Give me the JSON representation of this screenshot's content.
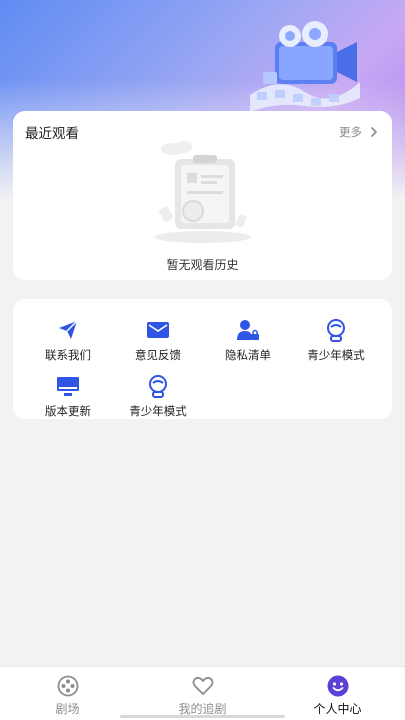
{
  "recent": {
    "title": "最近观看",
    "more_label": "更多",
    "empty_text": "暂无观看历史"
  },
  "tools": {
    "items": [
      {
        "label": "联系我们",
        "icon": "send-icon"
      },
      {
        "label": "意见反馈",
        "icon": "mail-icon"
      },
      {
        "label": "隐私清单",
        "icon": "privacy-user-icon"
      },
      {
        "label": "青少年模式",
        "icon": "teen-mode-icon"
      },
      {
        "label": "版本更新",
        "icon": "monitor-icon"
      },
      {
        "label": "青少年模式",
        "icon": "teen-mode-icon"
      }
    ]
  },
  "tabbar": {
    "items": [
      {
        "label": "剧场",
        "icon": "film-reel-icon",
        "active": false
      },
      {
        "label": "我的追剧",
        "icon": "heart-icon",
        "active": false
      },
      {
        "label": "个人中心",
        "icon": "smiley-icon",
        "active": true
      }
    ]
  },
  "colors": {
    "accent": "#2f55e4",
    "active_tab": "#5b3fd6",
    "inactive": "#8c8c8c"
  }
}
